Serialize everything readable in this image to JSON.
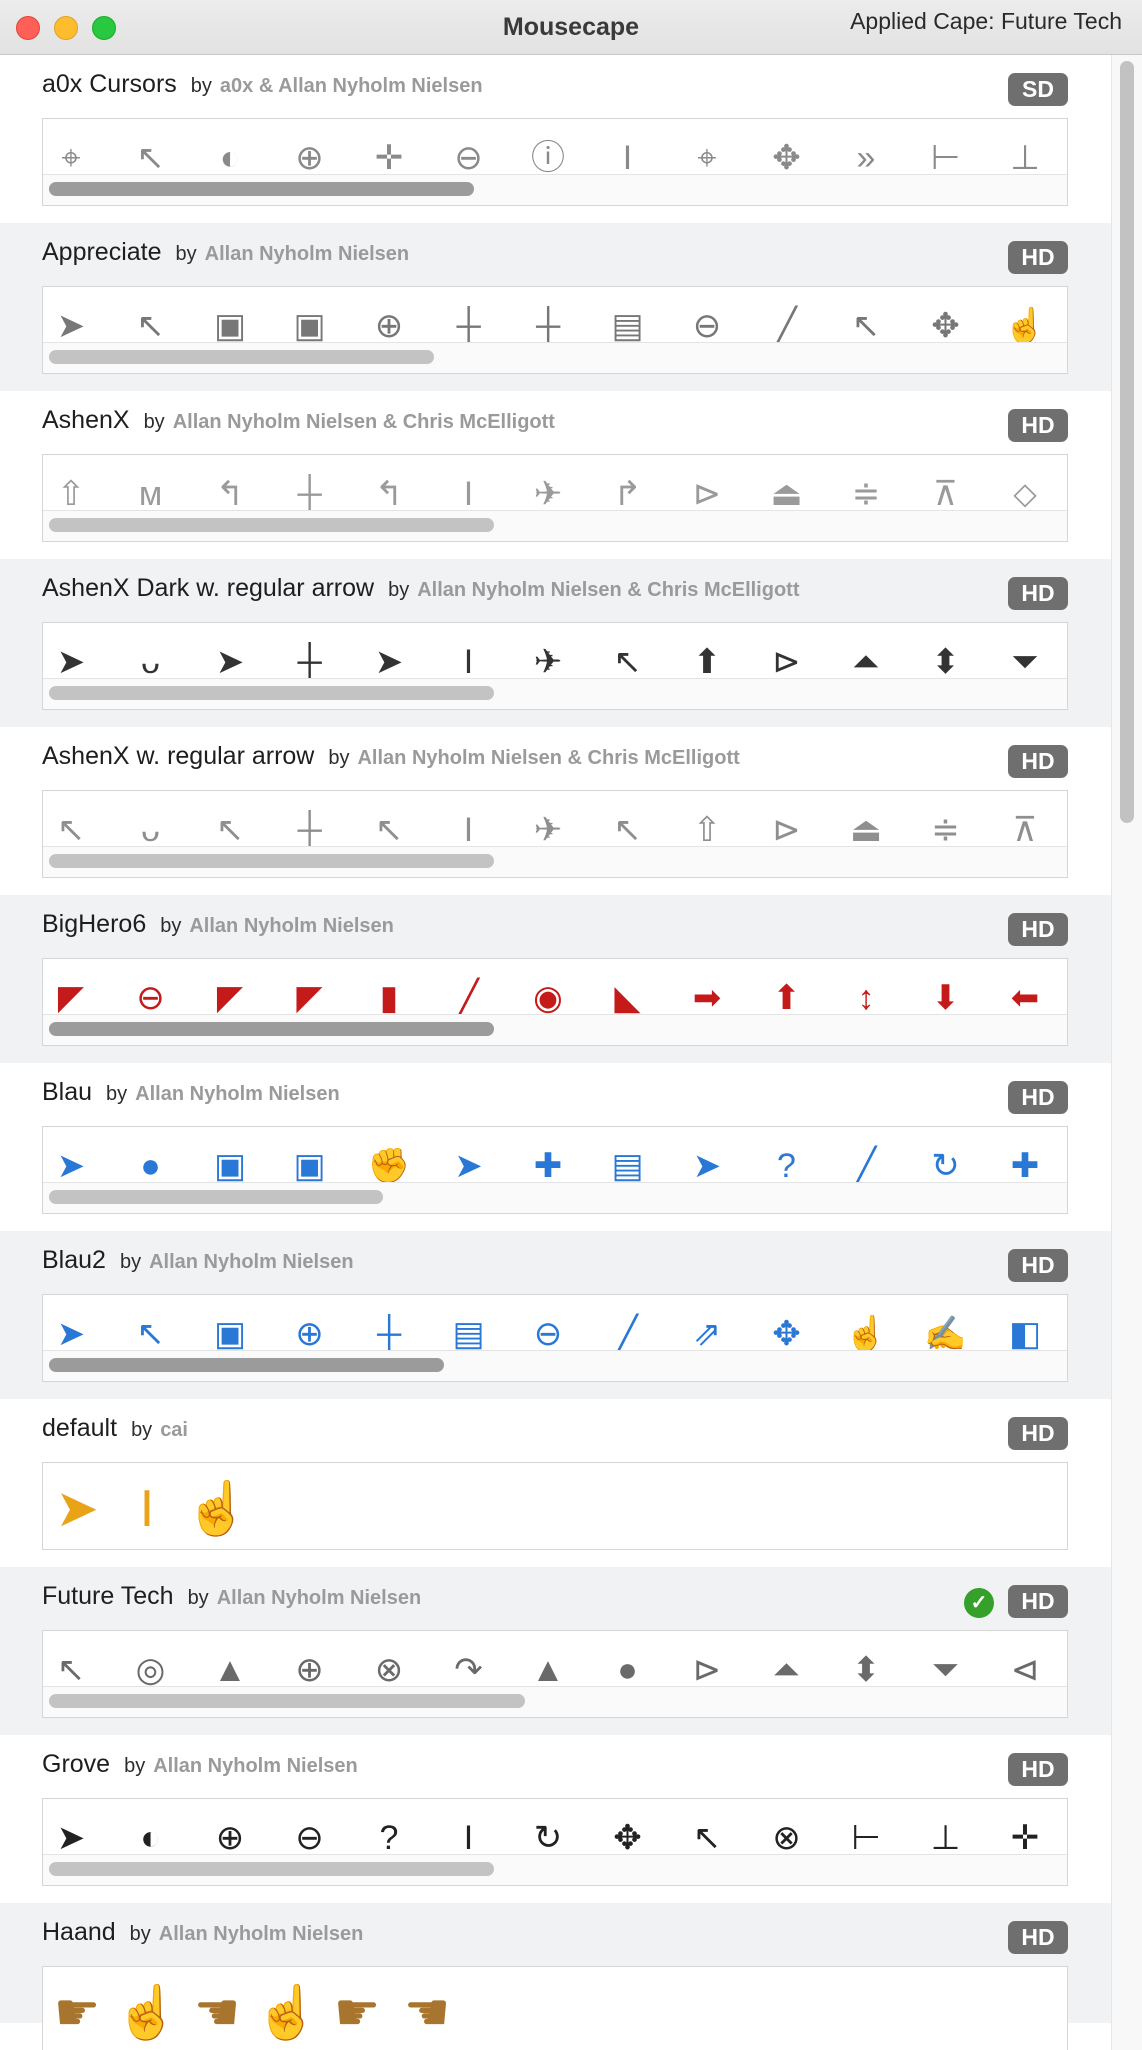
{
  "window": {
    "title": "Mousecape",
    "applied_label": "Applied Cape: Future Tech"
  },
  "capes": [
    {
      "name": "a0x Cursors",
      "by": "by",
      "author": "a0x & Allan Nyholm Nielsen",
      "badge": "SD",
      "applied": false,
      "color": "#8a8a8a",
      "icons": [
        "⌖",
        "↖",
        "◐",
        "⊕",
        "✛",
        "⊖",
        "ⓘ",
        "I",
        "⌖",
        "✥",
        "»",
        "⊢",
        "⊥"
      ],
      "hscroll": 0.42
    },
    {
      "name": "Appreciate",
      "by": "by",
      "author": "Allan Nyholm Nielsen",
      "badge": "HD",
      "applied": false,
      "color": "#777777",
      "icons": [
        "➤",
        "↖",
        "▣",
        "▣",
        "⊕",
        "┼",
        "┼",
        "▤",
        "⊖",
        "╱",
        "↖",
        "✥",
        "☝"
      ],
      "hscroll": 0.38
    },
    {
      "name": "AshenX",
      "by": "by",
      "author": "Allan Nyholm Nielsen & Chris McElligott",
      "badge": "HD",
      "applied": false,
      "color": "#9a9a9a",
      "icons": [
        "⇧",
        "ᴍ",
        "↰",
        "┼",
        "↰",
        "I",
        "✈",
        "↱",
        "⊳",
        "⏏",
        "≑",
        "⊼",
        "⬦"
      ],
      "hscroll": 0.44
    },
    {
      "name": "AshenX Dark w. regular arrow",
      "by": "by",
      "author": "Allan Nyholm Nielsen & Chris McElligott",
      "badge": "HD",
      "applied": false,
      "color": "#333333",
      "icons": [
        "➤",
        "ᴗ",
        "➤",
        "┼",
        "➤",
        "I",
        "✈",
        "↖",
        "⬆",
        "⊳",
        "⏶",
        "⬍",
        "⏷"
      ],
      "hscroll": 0.44
    },
    {
      "name": "AshenX w. regular arrow",
      "by": "by",
      "author": "Allan Nyholm Nielsen & Chris McElligott",
      "badge": "HD",
      "applied": false,
      "color": "#8f8f8f",
      "icons": [
        "↖",
        "ᴗ",
        "↖",
        "┼",
        "↖",
        "I",
        "✈",
        "↖",
        "⇧",
        "⊳",
        "⏏",
        "≑",
        "⊼"
      ],
      "hscroll": 0.44
    },
    {
      "name": "BigHero6",
      "by": "by",
      "author": "Allan Nyholm Nielsen",
      "badge": "HD",
      "applied": false,
      "color": "#c41a1a",
      "icons": [
        "◤",
        "⊖",
        "◤",
        "◤",
        "▮",
        "╱",
        "◉",
        "◣",
        "➡",
        "⬆",
        "↕",
        "⬇",
        "⬅"
      ],
      "hscroll": 0.44
    },
    {
      "name": "Blau",
      "by": "by",
      "author": "Allan Nyholm Nielsen",
      "badge": "HD",
      "applied": false,
      "color": "#2a78d6",
      "icons": [
        "➤",
        "●",
        "▣",
        "▣",
        "✊",
        "➤",
        "✚",
        "▤",
        "➤",
        "?",
        "╱",
        "↻",
        "✚"
      ],
      "hscroll": 0.33
    },
    {
      "name": "Blau2",
      "by": "by",
      "author": "Allan Nyholm Nielsen",
      "badge": "HD",
      "applied": false,
      "color": "#2a78d6",
      "icons": [
        "➤",
        "↖",
        "▣",
        "⊕",
        "┼",
        "▤",
        "⊖",
        "╱",
        "⇗",
        "✥",
        "☝",
        "✍",
        "◧"
      ],
      "hscroll": 0.39
    },
    {
      "name": "default",
      "by": "by",
      "author": "cai",
      "badge": "HD",
      "applied": false,
      "color": "#e8a317",
      "icons": [
        "➤",
        "I",
        "☝"
      ],
      "hscroll": null
    },
    {
      "name": "Future Tech",
      "by": "by",
      "author": "Allan Nyholm Nielsen",
      "badge": "HD",
      "applied": true,
      "color": "#6a6a6a",
      "icons": [
        "↖",
        "◎",
        "▲",
        "⊕",
        "⊗",
        "↷",
        "▲",
        "●",
        "⊳",
        "⏶",
        "⬍",
        "⏷",
        "⊲"
      ],
      "hscroll": 0.47
    },
    {
      "name": "Grove",
      "by": "by",
      "author": "Allan Nyholm Nielsen",
      "badge": "HD",
      "applied": false,
      "color": "#222222",
      "icons": [
        "➤",
        "◐",
        "⊕",
        "⊖",
        "?",
        "I",
        "↻",
        "✥",
        "↖",
        "⊗",
        "⊢",
        "⊥",
        "✛"
      ],
      "hscroll": 0.44
    },
    {
      "name": "Haand",
      "by": "by",
      "author": "Allan Nyholm Nielsen",
      "badge": "HD",
      "applied": false,
      "color": "#a8752e",
      "icons": [
        "☛",
        "☝",
        "☚",
        "☝",
        "☛",
        "☚"
      ],
      "hscroll": null
    }
  ]
}
